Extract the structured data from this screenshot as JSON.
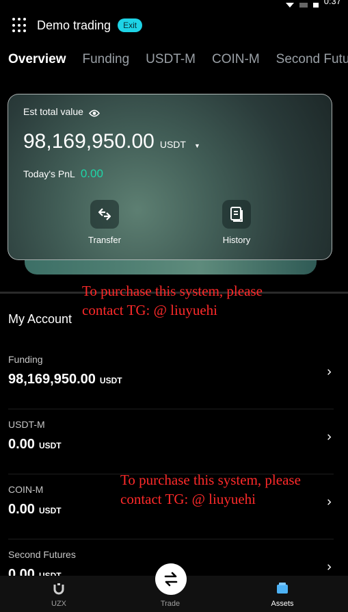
{
  "status": {
    "time": "0:37"
  },
  "header": {
    "title": "Demo trading",
    "exit_label": "Exit"
  },
  "tabs": [
    {
      "label": "Overview",
      "active": true
    },
    {
      "label": "Funding"
    },
    {
      "label": "USDT-M"
    },
    {
      "label": "COIN-M"
    },
    {
      "label": "Second Futu"
    }
  ],
  "card": {
    "label": "Est total value",
    "balance": "98,169,950.00",
    "currency": "USDT",
    "pnl_label": "Today's PnL",
    "pnl_value": "0.00",
    "actions": [
      {
        "label": "Transfer",
        "icon": "transfer-icon"
      },
      {
        "label": "History",
        "icon": "history-icon"
      }
    ]
  },
  "watermarks": [
    {
      "line1": "To purchase this system, please",
      "line2": "contact TG: @ liuyuehi"
    },
    {
      "line1": "To purchase this system, please",
      "line2": "contact TG: @ liuyuehi"
    }
  ],
  "my_account": {
    "title": "My Account",
    "items": [
      {
        "name": "Funding",
        "amount": "98,169,950.00",
        "currency": "USDT"
      },
      {
        "name": "USDT-M",
        "amount": "0.00",
        "currency": "USDT"
      },
      {
        "name": "COIN-M",
        "amount": "0.00",
        "currency": "USDT"
      },
      {
        "name": "Second Futures",
        "amount": "0.00",
        "currency": "USDT"
      }
    ]
  },
  "bottom_nav": [
    {
      "label": "UZX",
      "icon": "uzx-logo-icon"
    },
    {
      "label": "Trade",
      "icon": "swap-icon"
    },
    {
      "label": "Assets",
      "icon": "wallet-icon",
      "active": true
    }
  ],
  "colors": {
    "accent": "#1ed3e6",
    "pnl": "#1fd6a8",
    "watermark": "#ff2a2a",
    "background": "#000000"
  }
}
